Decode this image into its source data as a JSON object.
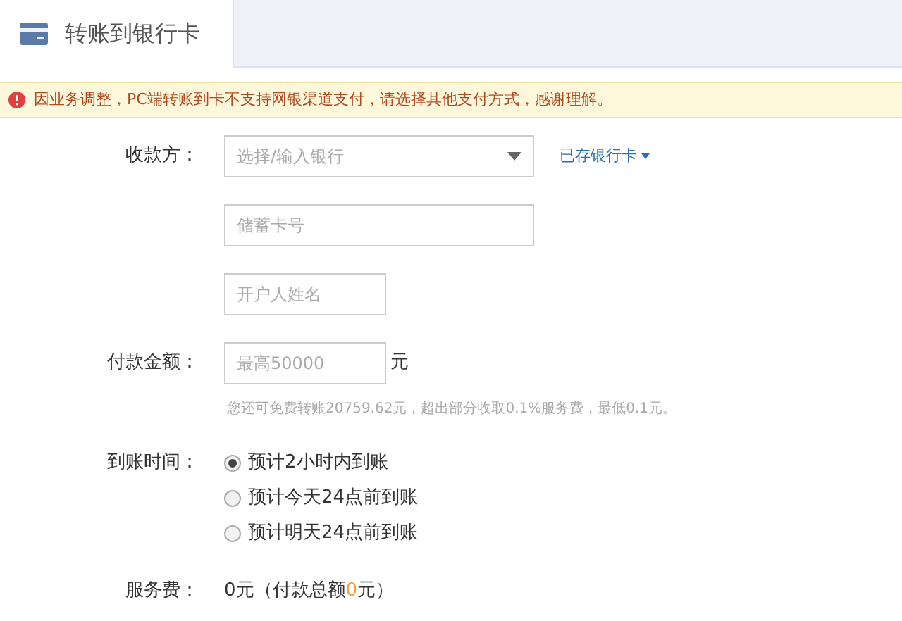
{
  "tabs": [
    {
      "label": "转账到银行卡",
      "selected": true
    }
  ],
  "notice": "因业务调整，PC端转账到卡不支持网银渠道支付，请选择其他支付方式，感谢理解。",
  "payee": {
    "label": "收款方：",
    "bank_select": {
      "placeholder": "选择/输入银行"
    },
    "saved_cards_link": "已存银行卡",
    "card_number": {
      "placeholder": "储蓄卡号"
    },
    "account_name": {
      "placeholder": "开户人姓名"
    }
  },
  "amount": {
    "label": "付款金额：",
    "field": {
      "placeholder": "最高50000"
    },
    "unit": "元",
    "hint": "您还可免费转账20759.62元，超出部分收取0.1%服务费，最低0.1元。"
  },
  "arrival": {
    "label": "到账时间：",
    "options": [
      {
        "label": "预计2小时内到账",
        "selected": true
      },
      {
        "label": "预计今天24点前到账",
        "selected": false
      },
      {
        "label": "预计明天24点前到账",
        "selected": false
      }
    ]
  },
  "fee": {
    "label": "服务费：",
    "value": "0元",
    "total_prefix": "（付款总额",
    "total_amount": "0",
    "total_suffix": "元）"
  }
}
